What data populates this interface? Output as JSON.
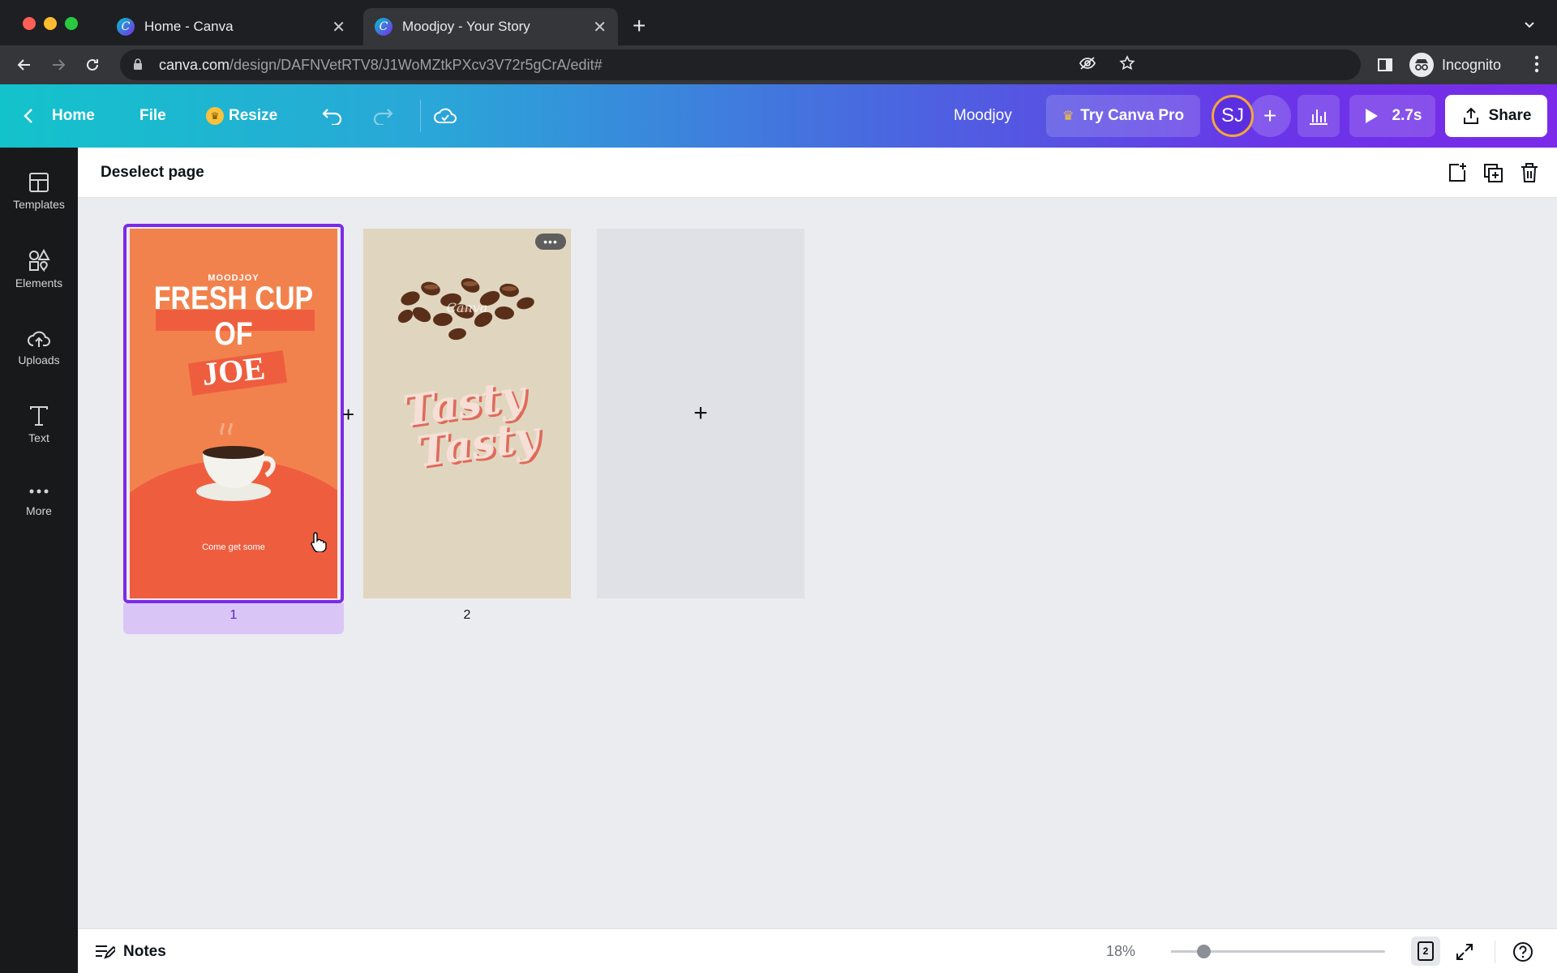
{
  "browser": {
    "tabs": [
      {
        "label": "Home - Canva",
        "favicon": "C"
      },
      {
        "label": "Moodjoy - Your Story",
        "favicon": "C"
      }
    ],
    "url_host": "canva.com",
    "url_path": "/design/DAFNVetRTV8/J1WoMZtkPXcv3V72r5gCrA/edit#",
    "incognito_label": "Incognito"
  },
  "toolbar": {
    "home": "Home",
    "file": "File",
    "resize": "Resize",
    "design_name": "Moodjoy",
    "try_pro": "Try Canva Pro",
    "avatar_initials": "SJ",
    "play_duration": "2.7s",
    "share": "Share"
  },
  "rail": {
    "items": [
      {
        "label": "Templates"
      },
      {
        "label": "Elements"
      },
      {
        "label": "Uploads"
      },
      {
        "label": "Text"
      },
      {
        "label": "More"
      }
    ]
  },
  "subbar": {
    "deselect": "Deselect page"
  },
  "pages": [
    {
      "number": "1",
      "brand": "MOODJOY",
      "headline_line1": "FRESH CUP",
      "headline_line2": "OF",
      "headline_line3": "JOE",
      "tagline": "Come get some",
      "bg": "#f2824d",
      "selected": true
    },
    {
      "number": "2",
      "watermark": "Canva",
      "headline_line1": "Tasty",
      "headline_line2": "Tasty",
      "bg": "#e0d6bf"
    }
  ],
  "footer": {
    "notes": "Notes",
    "zoom": "18%",
    "zoom_level": 0.15,
    "page_count": "2"
  },
  "colors": {
    "accent": "#7d2ae8",
    "toolbar_start": "#13c3cb",
    "toolbar_end": "#7a2ae8"
  }
}
